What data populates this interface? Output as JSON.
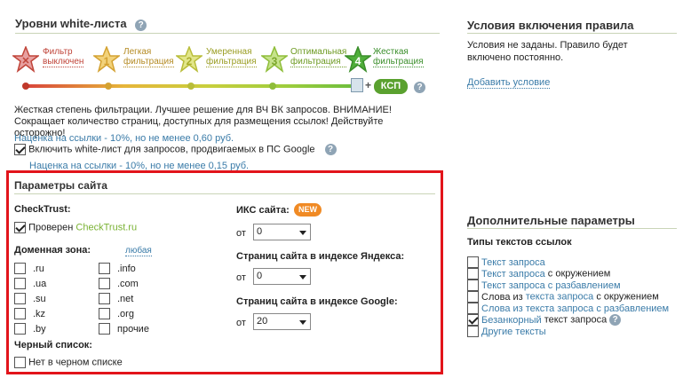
{
  "whitelist": {
    "title": "Уровни white-листа",
    "levels": [
      {
        "line1": "Фильтр",
        "line2": "выключен",
        "color": "#d9433b"
      },
      {
        "line1": "Легкая",
        "line2": "фильтрация",
        "color": "#e6b53a"
      },
      {
        "line1": "Умеренная",
        "line2": "фильтрация",
        "color": "#c9cf3d"
      },
      {
        "line1": "Оптимальная",
        "line2": "фильтрация",
        "color": "#9ccd3d"
      },
      {
        "line1": "Жесткая",
        "line2": "фильтрация",
        "color": "#6cbd3d"
      }
    ],
    "level_numbers": [
      "1",
      "2",
      "3",
      "4"
    ],
    "plus": "+",
    "ksp_label": "КСП",
    "description": "Жесткая степень фильтрации. Лучшее решение для ВЧ ВК запросов. ВНИМАНИЕ! Сокращает количество страниц, доступных для размещения ссылок! Действуйте осторожно!",
    "markup_note": "Наценка на ссылки - 10%, но не менее 0,60 руб.",
    "google_checkbox_label": "Включить white-лист для запросов, продвигаемых в ПС Google",
    "google_markup_note": "Наценка на ссылки - 10%, но не менее 0,15 руб."
  },
  "rule_conditions": {
    "title": "Условия включения правила",
    "text_line1": "Условия не заданы. Правило будет",
    "text_line2": "включено постоянно.",
    "add_link": "Добавить условие"
  },
  "site_params": {
    "title": "Параметры сайта",
    "checktrust_label": "CheckTrust:",
    "checked_by": "Проверен",
    "checktrust_link": "CheckTrust.ru",
    "domain_label": "Доменная зона:",
    "domain_any": "любая",
    "domains_col1": [
      ".ru",
      ".ua",
      ".su",
      ".kz",
      ".by"
    ],
    "domains_col2": [
      ".info",
      ".com",
      ".net",
      ".org",
      "прочие"
    ],
    "blacklist_label": "Черный список:",
    "blacklist_option": "Нет в черном списке",
    "iks_label": "ИКС сайта:",
    "new_badge": "NEW",
    "from_label": "от",
    "iks_value": "0",
    "yandex_label": "Страниц сайта в индексе Яндекса:",
    "yandex_value": "0",
    "google_label": "Страниц сайта в индексе Google:",
    "google_value": "20",
    "border_color": "#e2141b"
  },
  "additional": {
    "title": "Дополнительные параметры",
    "subtitle": "Типы текстов ссылок",
    "types": [
      {
        "link": "Текст запроса",
        "rest": "",
        "checked": false
      },
      {
        "link": "Текст запроса",
        "rest": " с окружением",
        "checked": false
      },
      {
        "link": "Текст запроса с разбавлением",
        "rest": "",
        "checked": false
      },
      {
        "link": "",
        "rest": "Слова из ",
        "mid": "текста запроса",
        "end": " с окружением",
        "checked": false
      },
      {
        "link": "Слова из текста запроса с разбавлением",
        "rest": "",
        "checked": false
      },
      {
        "link": "Безанкорный",
        "rest": " текст запроса",
        "checked": true,
        "help": true
      },
      {
        "link": "Другие тексты",
        "rest": "",
        "checked": false
      }
    ]
  }
}
